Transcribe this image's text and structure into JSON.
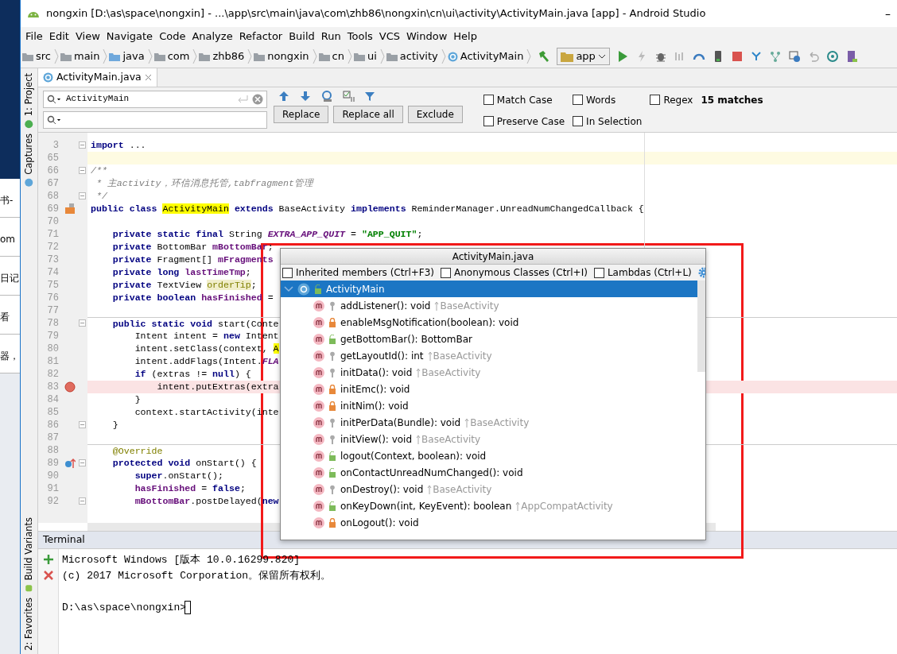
{
  "desktop": {
    "fragments": [
      "书-",
      "om",
      "日记",
      "看",
      "器，"
    ]
  },
  "window": {
    "title": "nongxin [D:\\as\\space\\nongxin] - ...\\app\\src\\main\\java\\com\\zhb86\\nongxin\\cn\\ui\\activity\\ActivityMain.java [app] - Android Studio",
    "minimize": "–"
  },
  "menu": [
    "File",
    "Edit",
    "View",
    "Navigate",
    "Code",
    "Analyze",
    "Refactor",
    "Build",
    "Run",
    "Tools",
    "VCS",
    "Window",
    "Help"
  ],
  "breadcrumbs": [
    {
      "label": "src",
      "kind": "folder"
    },
    {
      "label": "main",
      "kind": "folder"
    },
    {
      "label": "java",
      "kind": "source"
    },
    {
      "label": "com",
      "kind": "folder"
    },
    {
      "label": "zhb86",
      "kind": "folder"
    },
    {
      "label": "nongxin",
      "kind": "folder"
    },
    {
      "label": "cn",
      "kind": "folder"
    },
    {
      "label": "ui",
      "kind": "folder"
    },
    {
      "label": "activity",
      "kind": "folder"
    },
    {
      "label": "ActivityMain",
      "kind": "class"
    }
  ],
  "run_config": "app",
  "side_tools": [
    {
      "label": "1: Project",
      "kind": "project"
    },
    {
      "label": "Captures",
      "kind": "captures"
    },
    {
      "label": "Build Variants",
      "kind": "variants"
    },
    {
      "label": "2: Favorites",
      "kind": "favorites"
    }
  ],
  "tabs": [
    {
      "label": "ActivityMain.java",
      "selected": true
    }
  ],
  "find": {
    "search": "ActivityMain",
    "buttons": [
      "Replace",
      "Replace all",
      "Exclude"
    ],
    "options": [
      {
        "label": "Match Case",
        "checked": false
      },
      {
        "label": "Words",
        "checked": false
      },
      {
        "label": "Regex",
        "checked": false
      },
      {
        "label": "Preserve Case",
        "checked": false
      },
      {
        "label": "In Selection",
        "checked": false
      }
    ],
    "matches": "15 matches"
  },
  "code": [
    {
      "n": "3",
      "kind": "plain",
      "fold": true,
      "tokens": [
        {
          "text": "import ",
          "kind": "kw"
        },
        {
          "text": "...",
          "kind": "folded"
        }
      ]
    },
    {
      "n": "65",
      "kind": "current",
      "fold": false
    },
    {
      "n": "66",
      "kind": "plain",
      "fold": true,
      "tokens": [
        {
          "text": "/**",
          "kind": "doc"
        }
      ]
    },
    {
      "n": "67",
      "kind": "plain",
      "fold": false,
      "tokens": [
        {
          "text": " * 主activity，环信消息托管,tabfragment管理",
          "kind": "doc"
        }
      ]
    },
    {
      "n": "68",
      "kind": "plain",
      "fold": true,
      "tokens": [
        {
          "text": " */",
          "kind": "doc"
        }
      ]
    },
    {
      "n": "69",
      "kind": "implements",
      "fold": false,
      "tokens": [
        {
          "text": "public class ",
          "kind": "kw"
        },
        {
          "text": "ActivityMain",
          "kind": "match"
        },
        {
          "text": " extends ",
          "kind": "kw"
        },
        {
          "text": "BaseActivity ",
          "kind": "plain"
        },
        {
          "text": "implements ",
          "kind": "kw"
        },
        {
          "text": "ReminderManager.UnreadNumChangedCallback {",
          "kind": "plain"
        }
      ]
    },
    {
      "n": "70",
      "kind": "plain",
      "fold": false
    },
    {
      "n": "71",
      "kind": "plain",
      "fold": false,
      "tokens": [
        {
          "text": "    private static final ",
          "kind": "kw"
        },
        {
          "text": "String ",
          "kind": "plain"
        },
        {
          "text": "EXTRA_APP_QUIT",
          "kind": "const"
        },
        {
          "text": " = ",
          "kind": "plain"
        },
        {
          "text": "\"APP_QUIT\"",
          "kind": "str"
        },
        {
          "text": ";",
          "kind": "plain"
        }
      ]
    },
    {
      "n": "72",
      "kind": "plain",
      "fold": false,
      "tokens": [
        {
          "text": "    private ",
          "kind": "kw"
        },
        {
          "text": "BottomBar ",
          "kind": "plain"
        },
        {
          "text": "mBottomBar",
          "kind": "field"
        },
        {
          "text": ";",
          "kind": "plain"
        }
      ]
    },
    {
      "n": "73",
      "kind": "plain",
      "fold": false,
      "tokens": [
        {
          "text": "    private ",
          "kind": "kw"
        },
        {
          "text": "Fragment[] ",
          "kind": "plain"
        },
        {
          "text": "mFragments",
          "kind": "field"
        }
      ]
    },
    {
      "n": "74",
      "kind": "plain",
      "fold": false,
      "tokens": [
        {
          "text": "    private long ",
          "kind": "kw"
        },
        {
          "text": "lastTimeTmp",
          "kind": "field"
        },
        {
          "text": ";",
          "kind": "plain"
        }
      ]
    },
    {
      "n": "75",
      "kind": "plain",
      "fold": false,
      "tokens": [
        {
          "text": "    private ",
          "kind": "kw"
        },
        {
          "text": "TextView ",
          "kind": "plain"
        },
        {
          "text": "orderTip",
          "kind": "unused"
        },
        {
          "text": ";",
          "kind": "plain"
        }
      ]
    },
    {
      "n": "76",
      "kind": "plain",
      "fold": false,
      "tokens": [
        {
          "text": "    private boolean ",
          "kind": "kw"
        },
        {
          "text": "hasFinished",
          "kind": "field"
        },
        {
          "text": " =",
          "kind": "plain"
        }
      ]
    },
    {
      "n": "77",
      "kind": "plain",
      "fold": false
    },
    {
      "n": "78",
      "kind": "plain",
      "fold": true,
      "separator": true,
      "tokens": [
        {
          "text": "    public static void ",
          "kind": "kw"
        },
        {
          "text": "start(Conte",
          "kind": "plain"
        }
      ]
    },
    {
      "n": "79",
      "kind": "plain",
      "fold": false,
      "tokens": [
        {
          "text": "        Intent intent = ",
          "kind": "plain"
        },
        {
          "text": "new ",
          "kind": "kw"
        },
        {
          "text": "Intent",
          "kind": "plain"
        }
      ]
    },
    {
      "n": "80",
      "kind": "plain",
      "fold": false,
      "tokens": [
        {
          "text": "        intent.setClass(context, ",
          "kind": "plain"
        },
        {
          "text": "A",
          "kind": "match"
        }
      ]
    },
    {
      "n": "81",
      "kind": "plain",
      "fold": false,
      "tokens": [
        {
          "text": "        intent.addFlags(Intent.",
          "kind": "plain"
        },
        {
          "text": "FLA",
          "kind": "const"
        }
      ]
    },
    {
      "n": "82",
      "kind": "plain",
      "fold": false,
      "tokens": [
        {
          "text": "        if ",
          "kind": "kw"
        },
        {
          "text": "(extras != ",
          "kind": "plain"
        },
        {
          "text": "null",
          "kind": "kw"
        },
        {
          "text": ") {",
          "kind": "plain"
        }
      ]
    },
    {
      "n": "83",
      "kind": "breakpoint",
      "fold": false,
      "tokens": [
        {
          "text": "            intent.putExtras(extra",
          "kind": "plain"
        }
      ]
    },
    {
      "n": "84",
      "kind": "plain",
      "fold": false,
      "tokens": [
        {
          "text": "        }",
          "kind": "plain"
        }
      ]
    },
    {
      "n": "85",
      "kind": "plain",
      "fold": false,
      "tokens": [
        {
          "text": "        context.startActivity(inte",
          "kind": "plain"
        }
      ]
    },
    {
      "n": "86",
      "kind": "plain",
      "fold": true,
      "tokens": [
        {
          "text": "    }",
          "kind": "plain"
        }
      ]
    },
    {
      "n": "87",
      "kind": "plain",
      "fold": false
    },
    {
      "n": "88",
      "kind": "plain",
      "fold": false,
      "separator": true,
      "tokens": [
        {
          "text": "    @Override",
          "kind": "anno"
        }
      ]
    },
    {
      "n": "89",
      "kind": "override",
      "fold": true,
      "tokens": [
        {
          "text": "    protected void ",
          "kind": "kw"
        },
        {
          "text": "onStart() {",
          "kind": "plain"
        }
      ]
    },
    {
      "n": "90",
      "kind": "plain",
      "fold": false,
      "tokens": [
        {
          "text": "        super",
          "kind": "kw"
        },
        {
          "text": ".onStart();",
          "kind": "plain"
        }
      ]
    },
    {
      "n": "91",
      "kind": "plain",
      "fold": false,
      "tokens": [
        {
          "text": "        hasFinished",
          "kind": "field"
        },
        {
          "text": " = ",
          "kind": "plain"
        },
        {
          "text": "false",
          "kind": "kw"
        },
        {
          "text": ";",
          "kind": "plain"
        }
      ]
    },
    {
      "n": "92",
      "kind": "plain",
      "fold": true,
      "tokens": [
        {
          "text": "        mBottomBar",
          "kind": "field"
        },
        {
          "text": ".postDelayed(",
          "kind": "plain"
        },
        {
          "text": "new",
          "kind": "kw"
        }
      ]
    }
  ],
  "structure": {
    "title": "ActivityMain.java",
    "options": [
      {
        "label": "Inherited members (Ctrl+F3)",
        "checked": false
      },
      {
        "label": "Anonymous Classes (Ctrl+I)",
        "checked": false
      },
      {
        "label": "Lambdas (Ctrl+L)",
        "checked": false
      }
    ],
    "root": {
      "label": "ActivityMain",
      "expanded": true,
      "selected": true
    },
    "members": [
      {
        "name": "addListener(): void",
        "kind": "protected",
        "origin": "BaseActivity"
      },
      {
        "name": "enableMsgNotification(boolean): void",
        "kind": "private"
      },
      {
        "name": "getBottomBar(): BottomBar",
        "kind": "public"
      },
      {
        "name": "getLayoutId(): int",
        "kind": "protected",
        "origin": "BaseActivity"
      },
      {
        "name": "initData(): void",
        "kind": "protected",
        "origin": "BaseActivity"
      },
      {
        "name": "initEmc(): void",
        "kind": "private"
      },
      {
        "name": "initNim(): void",
        "kind": "private"
      },
      {
        "name": "initPerData(Bundle): void",
        "kind": "protected",
        "origin": "BaseActivity"
      },
      {
        "name": "initView(): void",
        "kind": "protected",
        "origin": "BaseActivity"
      },
      {
        "name": "logout(Context, boolean): void",
        "kind": "public"
      },
      {
        "name": "onContactUnreadNumChanged(): void",
        "kind": "public"
      },
      {
        "name": "onDestroy(): void",
        "kind": "protected",
        "origin": "BaseActivity"
      },
      {
        "name": "onKeyDown(int, KeyEvent): boolean",
        "kind": "public",
        "origin": "AppCompatActivity"
      },
      {
        "name": "onLogout(): void",
        "kind": "private"
      }
    ]
  },
  "terminal": {
    "title": "Terminal",
    "output": [
      "Microsoft Windows [版本 10.0.16299.820]",
      "(c) 2017 Microsoft Corporation。保留所有权利。"
    ],
    "prompt": "D:\\as\\space\\nongxin>",
    "cursor": true
  }
}
